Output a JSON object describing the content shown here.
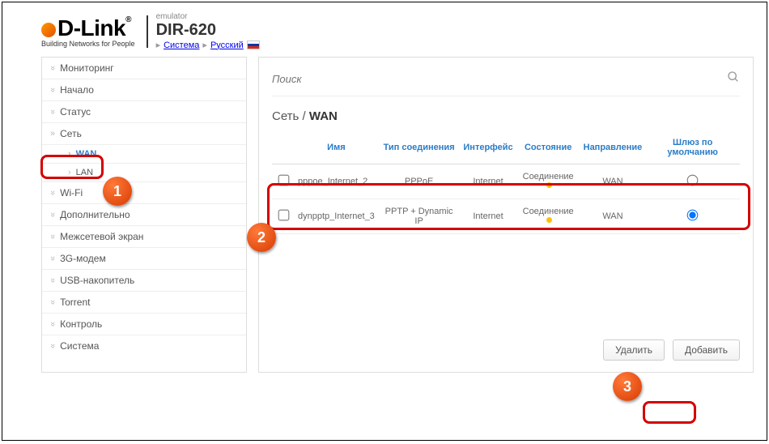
{
  "logo": {
    "brand": "D-Link",
    "tagline": "Building Networks for People",
    "emulator": "emulator",
    "model": "DIR-620"
  },
  "crumbs": {
    "system": "Система",
    "lang": "Русский"
  },
  "search": {
    "placeholder": "Поиск"
  },
  "sidebar": {
    "items": [
      "Мониторинг",
      "Начало",
      "Статус",
      "Сеть",
      "Wi-Fi",
      "Дополнительно",
      "Межсетевой экран",
      "3G-модем",
      "USB-накопитель",
      "Torrent",
      "Контроль",
      "Система"
    ],
    "subs": {
      "wan": "WAN",
      "lan": "LAN"
    }
  },
  "breadcrumb": {
    "parent": "Сеть",
    "sep": " / ",
    "current": "WAN"
  },
  "table": {
    "headers": {
      "name": "Имя",
      "conn": "Тип соединения",
      "iface": "Интерфейс",
      "state": "Состояние",
      "dir": "Направление",
      "gw": "Шлюз по умолчанию"
    },
    "rows": [
      {
        "name": "pppoe_Internet_2",
        "conn": "PPPoE",
        "iface": "Internet",
        "state": "Соединение",
        "dir": "WAN",
        "gw": false
      },
      {
        "name": "dynpptp_Internet_3",
        "conn": "PPTP + Dynamic IP",
        "iface": "Internet",
        "state": "Соединение",
        "dir": "WAN",
        "gw": true
      }
    ]
  },
  "buttons": {
    "delete": "Удалить",
    "add": "Добавить"
  },
  "markers": {
    "one": "1",
    "two": "2",
    "three": "3"
  }
}
